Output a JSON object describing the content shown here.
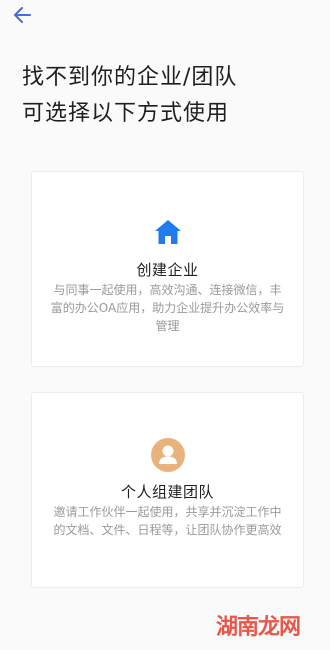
{
  "header": {
    "back_icon": "arrow-left-icon",
    "title_line_1": "找不到你的企业/团队",
    "title_line_2": "可选择以下方式使用"
  },
  "options": {
    "enterprise": {
      "icon": "home-icon",
      "icon_color": "#1e7cf0",
      "title": "创建企业",
      "description": "与同事一起使用，高效沟通、连接微信，丰富的办公OA应用，助力企业提升办公效率与管理"
    },
    "team": {
      "icon": "person-icon",
      "icon_color": "#e9b27a",
      "title": "个人组建团队",
      "description": "邀请工作伙伴一起使用，共享并沉淀工作中的文档、文件、日程等，让团队协作更高效"
    }
  },
  "watermark": {
    "text": "湖南龙网",
    "color": "#e84a3c"
  }
}
